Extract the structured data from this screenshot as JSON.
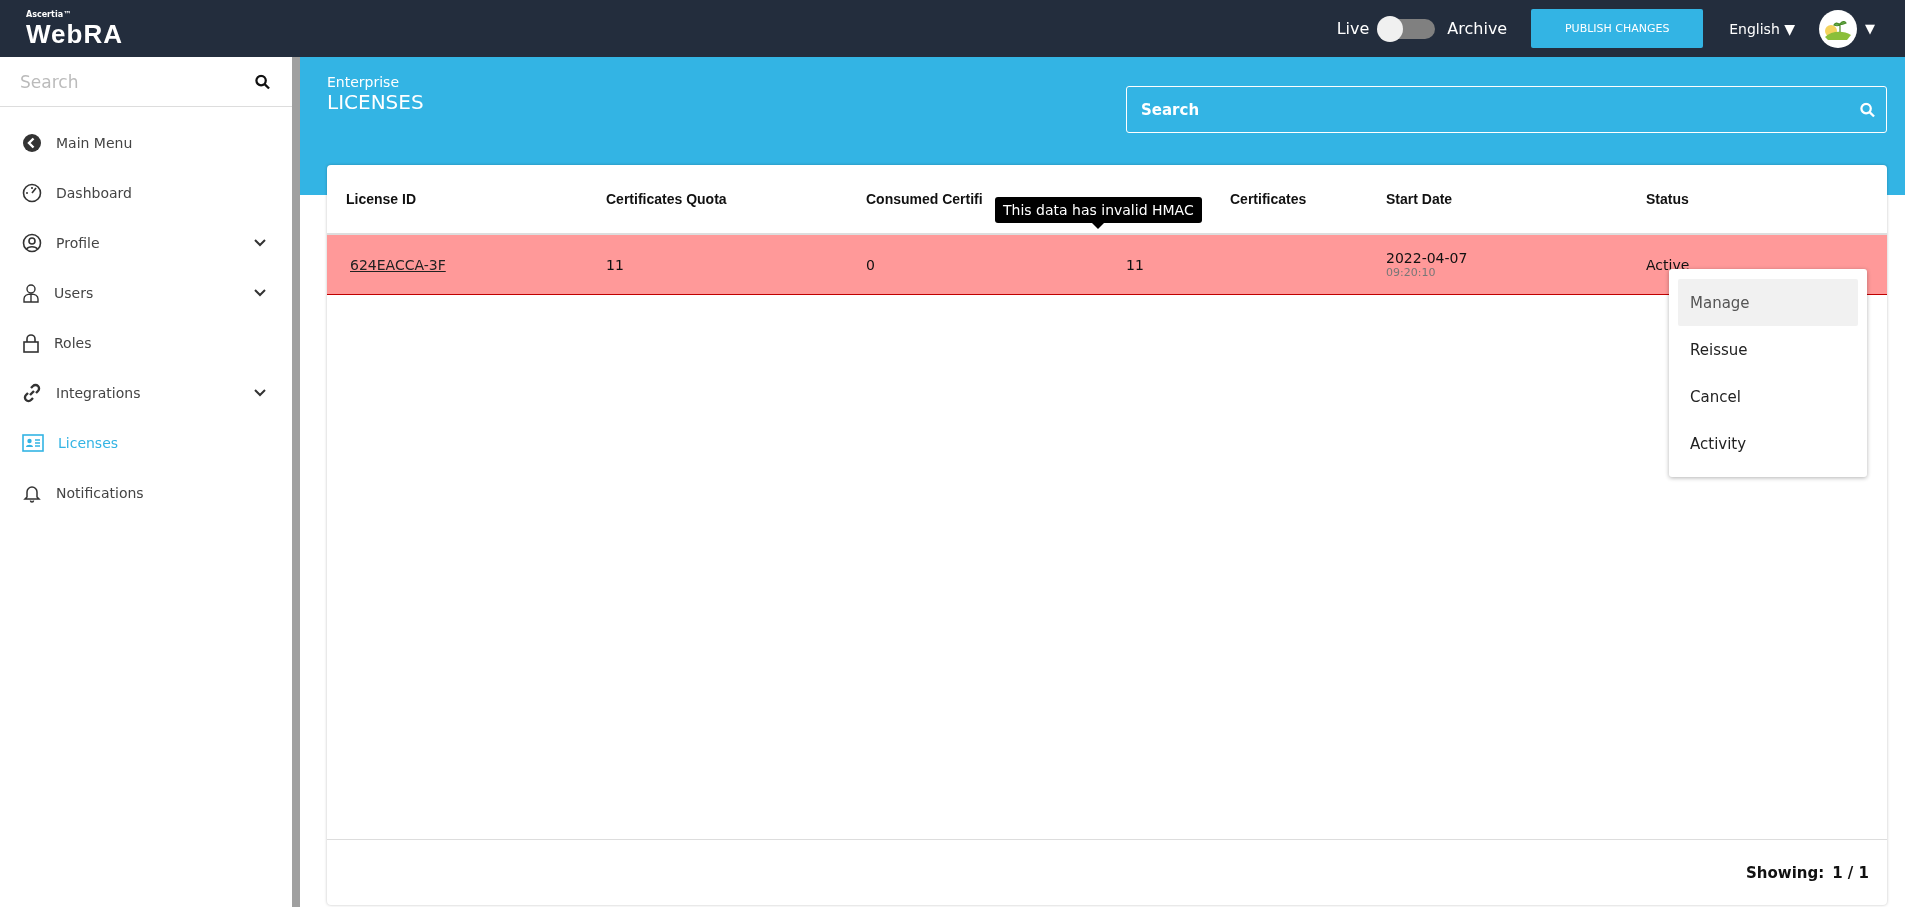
{
  "header": {
    "brand_small": "Ascertia™",
    "brand": "WebRA",
    "toggle": {
      "left_label": "Live",
      "right_label": "Archive",
      "on": false
    },
    "publish_button": "PUBLISH CHANGES",
    "language": "English ▼",
    "avatar_caret": "▼"
  },
  "sidebar": {
    "search": {
      "placeholder": "Search"
    },
    "items": [
      {
        "label": "Main Menu",
        "submenu": false,
        "selected": false
      },
      {
        "label": "Dashboard",
        "submenu": false,
        "selected": false
      },
      {
        "label": "Profile",
        "submenu": true,
        "selected": false
      },
      {
        "label": "Users",
        "submenu": true,
        "selected": false
      },
      {
        "label": "Roles",
        "submenu": false,
        "selected": false
      },
      {
        "label": "Integrations",
        "submenu": true,
        "selected": false
      },
      {
        "label": "Licenses",
        "submenu": false,
        "selected": true
      },
      {
        "label": "Notifications",
        "submenu": false,
        "selected": false
      }
    ]
  },
  "page": {
    "subtitle": "Enterprise",
    "title": "LICENSES",
    "search": {
      "placeholder": "Search"
    }
  },
  "table": {
    "columns": [
      "License ID",
      "Certificates Quota",
      "Consumed Certifi",
      "Certificates",
      "Start Date",
      "Status"
    ],
    "rows": [
      {
        "license_id": "624EACCA-3F",
        "quota": "11",
        "consumed": "0",
        "remaining": "11",
        "start_date": "2022-04-07",
        "start_time": "09:20:10",
        "status": "Active",
        "invalid": true
      }
    ],
    "tooltip": "This data has invalid HMAC",
    "row_menu": [
      {
        "label": "Manage",
        "selected": true
      },
      {
        "label": "Reissue",
        "selected": false
      },
      {
        "label": "Cancel",
        "selected": false
      },
      {
        "label": "Activity",
        "selected": false
      }
    ],
    "footer": {
      "label": "Showing:",
      "value": "1 / 1"
    }
  }
}
